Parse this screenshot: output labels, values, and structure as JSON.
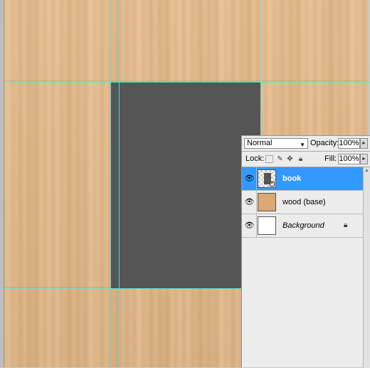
{
  "layers_panel": {
    "blend_mode": "Normal",
    "opacity_label": "Opacity:",
    "opacity_value": "100%",
    "lock_label": "Lock:",
    "fill_label": "Fill:",
    "fill_value": "100%",
    "layers": [
      {
        "name": "book",
        "selected": true,
        "visible": true,
        "thumb": "book-thumbnail"
      },
      {
        "name": "wood (base)",
        "selected": false,
        "visible": true,
        "thumb": "wood-thumbnail"
      },
      {
        "name": "Background",
        "selected": false,
        "visible": true,
        "locked": true,
        "thumb": "white-thumbnail"
      }
    ]
  },
  "icons": {
    "eye": "eye-icon",
    "lock_transparent": "lock-transparent-pixels-icon",
    "lock_image": "lock-image-pixels-icon",
    "lock_position": "lock-position-icon",
    "lock_all": "lock-all-icon",
    "dropdown": "chevron-down-icon",
    "stepper": "chevron-right-icon"
  },
  "colors": {
    "wood": "#e3ba8a",
    "book_fill": "#555555",
    "guide": "#5ce6e6",
    "selection": "#3399ff"
  }
}
